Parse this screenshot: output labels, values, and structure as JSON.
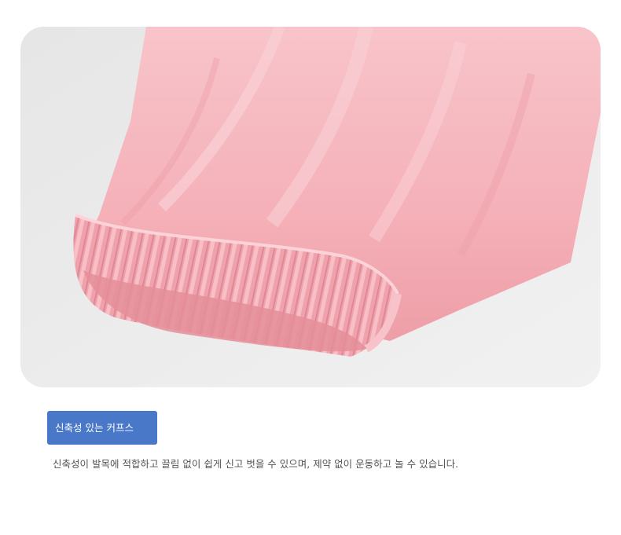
{
  "feature": {
    "title": "신축성 있는 커프스",
    "description": "신축성이 발목에 적합하고 끌림 없이 쉽게 신고 벗을 수 있으며, 제약 없이 운동하고 놀 수 있습니다."
  },
  "colors": {
    "badge_bg": "#4a78c8",
    "fabric": "#f6b3bb",
    "backdrop": "#ececec"
  }
}
